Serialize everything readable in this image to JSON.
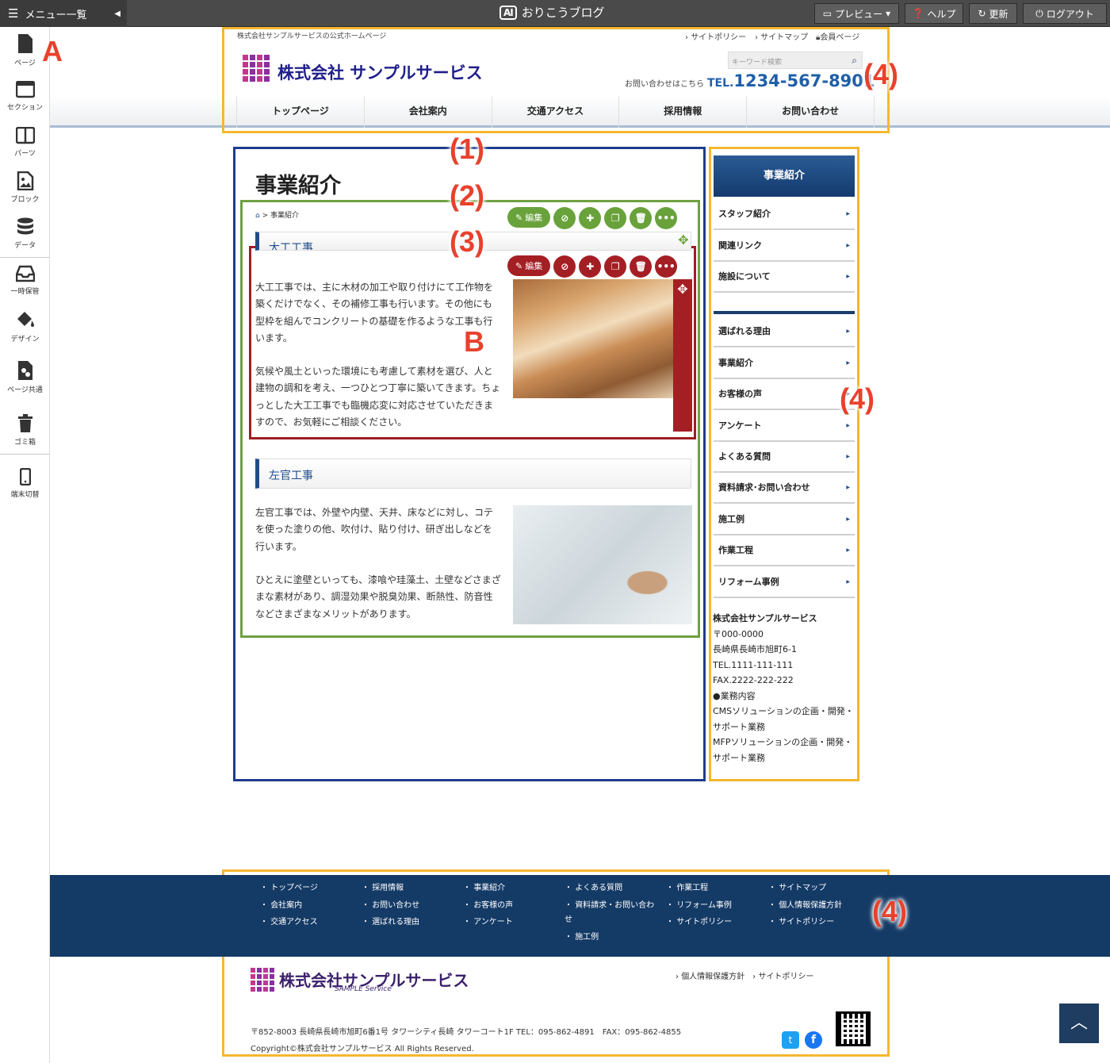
{
  "cms": {
    "menu_label": "メニュー一覧",
    "brand": "おりこうブログ",
    "buttons": {
      "preview": "プレビュー",
      "help": "ヘルプ",
      "refresh": "更新",
      "logout": "ログアウト"
    },
    "sidebar": [
      {
        "label": "ページ",
        "icon": "page-icon"
      },
      {
        "label": "セクション",
        "icon": "section-icon"
      },
      {
        "label": "パーツ",
        "icon": "parts-icon"
      },
      {
        "label": "ブロック",
        "icon": "block-icon"
      },
      {
        "label": "データ",
        "icon": "database-icon"
      },
      {
        "label": "一時保管",
        "icon": "inbox-icon"
      },
      {
        "label": "デザイン",
        "icon": "paint-bucket-icon"
      },
      {
        "label": "ページ共通",
        "icon": "shared-page-icon"
      },
      {
        "label": "ゴミ箱",
        "icon": "trash-icon"
      },
      {
        "label": "端末切替",
        "icon": "mobile-icon"
      }
    ]
  },
  "annotations": {
    "A": "A",
    "B": "B",
    "n1": "(1)",
    "n2": "(2)",
    "n3": "(3)",
    "n4": "(4)"
  },
  "site": {
    "tagline": "株式会社サンプルサービスの公式ホームページ",
    "toplinks": [
      "サイトポリシー",
      "サイトマップ",
      "会員ページ"
    ],
    "company": "株式会社 サンプルサービス",
    "search_placeholder": "キーワード検索",
    "inquiry": "お問い合わせはこちら",
    "tel_prefix": "TEL.",
    "tel": "1234-567-8901",
    "nav": [
      "トップページ",
      "会社案内",
      "交通アクセス",
      "採用情報",
      "お問い合わせ"
    ]
  },
  "content": {
    "page_title": "事業紹介",
    "breadcrumb": "事業紹介",
    "edit_label": "編集",
    "section1": {
      "heading": "大工工事",
      "p1": "大工工事では、主に木材の加工や取り付けにて工作物を築くだけでなく、その補修工事も行います。その他にも型枠を組んでコンクリートの基礎を作るような工事も行います。",
      "p2": "気候や風土といった環境にも考慮して素材を選び、人と建物の調和を考え、一つひとつ丁寧に築いてきます。ちょっとした大工工事でも臨機応変に対応させていただきますので、お気軽にご相談ください。"
    },
    "section2": {
      "heading": "左官工事",
      "p1": "左官工事では、外壁や内壁、天井、床などに対し、コテを使った塗りの他、吹付け、貼り付け、研ぎ出しなどを行います。",
      "p2": "ひとえに塗壁といっても、漆喰や珪藻土、土壁などさまざまな素材があり、調湿効果や脱臭効果、断熱性、防音性などさまざまなメリットがあります。"
    }
  },
  "side": {
    "head": "事業紹介",
    "group1": [
      "スタッフ紹介",
      "関連リンク",
      "施設について"
    ],
    "group2": [
      "選ばれる理由",
      "事業紹介",
      "お客様の声",
      "アンケート",
      "よくある質問",
      "資料請求･お問い合わせ",
      "施工例",
      "作業工程",
      "リフォーム事例"
    ],
    "info": [
      "株式会社サンプルサービス",
      "〒000-0000",
      "長崎県長崎市旭町6-1",
      "TEL.1111-111-111",
      "FAX.2222-222-222",
      "●業務内容",
      "CMSソリューションの企画・開発・",
      "サポート業務",
      "MFPソリューションの企画・開発・",
      "サポート業務"
    ]
  },
  "footer": {
    "col1": [
      "トップページ",
      "会社案内",
      "交通アクセス"
    ],
    "col2": [
      "採用情報",
      "お問い合わせ",
      "選ばれる理由"
    ],
    "col3": [
      "事業紹介",
      "お客様の声",
      "アンケート"
    ],
    "col4": [
      "よくある質問",
      "資料請求・お問い合わ",
      "せ",
      "施工例"
    ],
    "col5": [
      "作業工程",
      "リフォーム事例",
      "サイトポリシー"
    ],
    "col6": [
      "サイトマップ",
      "個人情報保護方針",
      "サイトポリシー"
    ],
    "company": "株式会社サンプルサービス",
    "company_sub": "SAMPLE Service",
    "links": [
      "個人情報保護方針",
      "サイトポリシー"
    ],
    "address": "〒852-8003 長崎県長崎市旭町6番1号 タワーシティ長崎 タワーコート1F TEL：095-862-4891　FAX：095-862-4855",
    "copyright": "Copyright©株式会社サンプルサービス All Rights Reserved."
  },
  "colors": {
    "frame_orange": "#f5b731",
    "frame_blue": "#1f3c8c",
    "frame_green": "#6fa043",
    "frame_red": "#9c1f22",
    "annotation_red": "#e8412c"
  }
}
